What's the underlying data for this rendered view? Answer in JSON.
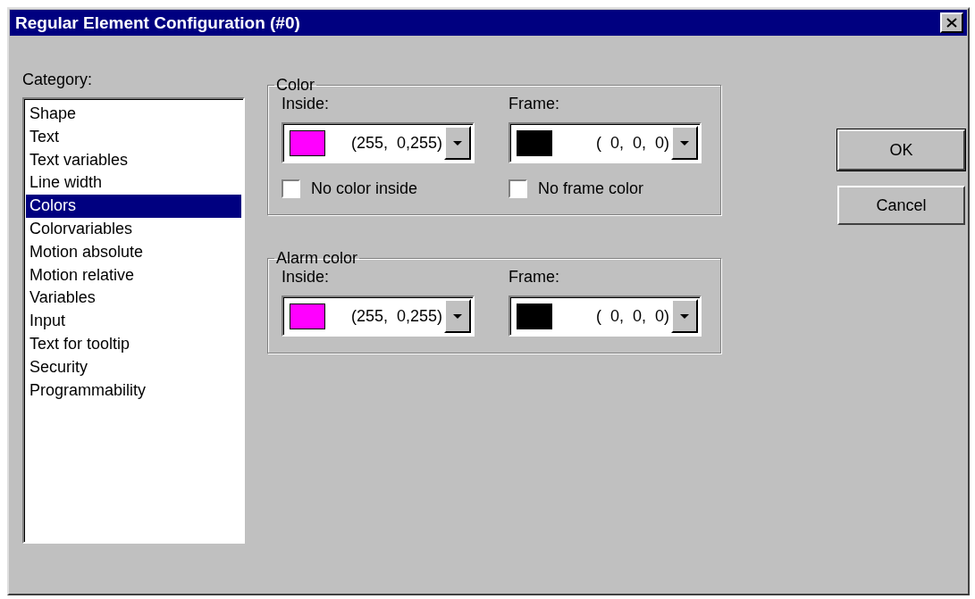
{
  "window": {
    "title": "Regular Element Configuration (#0)"
  },
  "category": {
    "label": "Category:",
    "items": [
      {
        "label": "Shape",
        "selected": false
      },
      {
        "label": "Text",
        "selected": false
      },
      {
        "label": "Text variables",
        "selected": false
      },
      {
        "label": "Line width",
        "selected": false
      },
      {
        "label": "Colors",
        "selected": true
      },
      {
        "label": "Colorvariables",
        "selected": false
      },
      {
        "label": "Motion absolute",
        "selected": false
      },
      {
        "label": "Motion relative",
        "selected": false
      },
      {
        "label": "Variables",
        "selected": false
      },
      {
        "label": "Input",
        "selected": false
      },
      {
        "label": "Text for tooltip",
        "selected": false
      },
      {
        "label": "Security",
        "selected": false
      },
      {
        "label": "Programmability",
        "selected": false
      }
    ]
  },
  "groups": [
    {
      "title": "Color",
      "pickers": [
        {
          "label": "Inside:",
          "color": "#ff00ff",
          "value": "(255,  0,255)",
          "checkbox": {
            "label": "No color inside",
            "checked": false
          }
        },
        {
          "label": "Frame:",
          "color": "#000000",
          "value": "(  0,  0,  0)",
          "checkbox": {
            "label": "No frame color",
            "checked": false
          }
        }
      ]
    },
    {
      "title": "Alarm color",
      "pickers": [
        {
          "label": "Inside:",
          "color": "#ff00ff",
          "value": "(255,  0,255)"
        },
        {
          "label": "Frame:",
          "color": "#000000",
          "value": "(  0,  0,  0)"
        }
      ]
    }
  ],
  "buttons": [
    {
      "label": "OK",
      "default": true
    },
    {
      "label": "Cancel",
      "default": false
    }
  ]
}
